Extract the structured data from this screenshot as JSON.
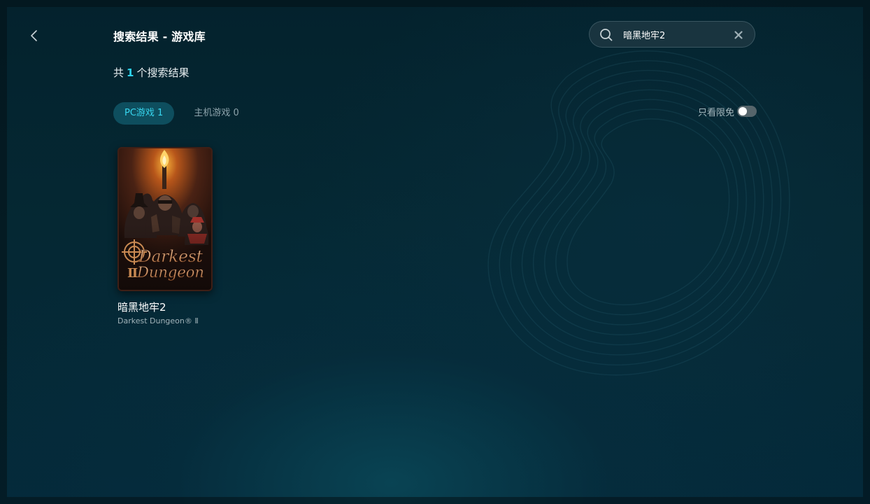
{
  "header": {
    "title": "搜索结果 - 游戏库"
  },
  "results": {
    "prefix": "共",
    "count": "1",
    "suffix": "个搜索结果"
  },
  "search": {
    "value": "暗黑地牢2",
    "placeholder": ""
  },
  "tabs": [
    {
      "label": "PC游戏 1",
      "active": true
    },
    {
      "label": "主机游戏 0",
      "active": false
    }
  ],
  "filter": {
    "free_only_label": "只看限免",
    "free_only_on": false
  },
  "games": [
    {
      "title": "暗黑地牢2",
      "subtitle": "Darkest Dungeon® Ⅱ",
      "cover_logo_line1": "Darkest",
      "cover_logo_line2": "Dungeon"
    }
  ],
  "colors": {
    "accent": "#2ed3ec",
    "background": "#052833",
    "tab_active_bg": "#125c6e"
  },
  "icons": {
    "back": "chevron-left-icon",
    "search": "search-icon",
    "clear": "close-icon"
  }
}
